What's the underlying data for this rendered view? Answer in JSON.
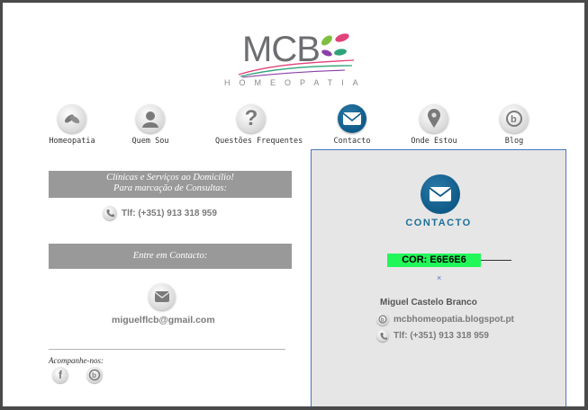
{
  "brand": {
    "name": "MCB",
    "subtitle": "HOMEOPATIA"
  },
  "nav": [
    {
      "label": "Homeopatia",
      "icon": "leaves-icon"
    },
    {
      "label": "Quem Sou",
      "icon": "person-icon"
    },
    {
      "label": "Questões Frequentes",
      "icon": "question-icon"
    },
    {
      "label": "Contacto",
      "icon": "mail-icon",
      "active": true
    },
    {
      "label": "Onde Estou",
      "icon": "map-pin-icon"
    },
    {
      "label": "Blog",
      "icon": "blog-icon"
    }
  ],
  "left": {
    "services_line1": "Clínicas e Serviços ao Domicílio!",
    "services_line2": "Para marcação de Consultas:",
    "phone": "Tlf: (+351) 913 318 959",
    "contact_heading": "Entre em Contacto:",
    "email": "miguelflcb@gmail.com",
    "follow_label": "Acompanhe-nos:"
  },
  "panel": {
    "title": "CONTACTO",
    "color_tag": "COR: E6E6E6",
    "close_mark": "×",
    "name": "Miguel Castelo Branco",
    "blog": "mcbhomeopatia.blogspot.pt",
    "phone": "Tlf: (+351) 913 318 959"
  },
  "colors": {
    "accent_blue": "#0f5a87",
    "panel_bg": "#e6e6e6",
    "bar_gray": "#999999",
    "tag_green": "#22f75a"
  }
}
